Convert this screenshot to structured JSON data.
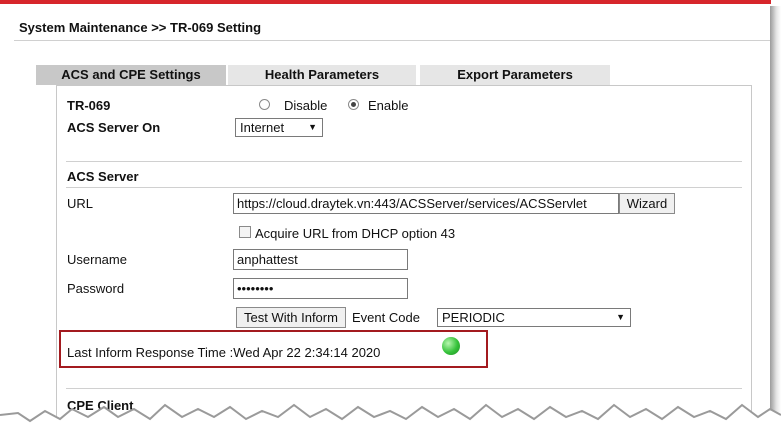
{
  "header": {
    "title": "System Maintenance >> TR-069 Setting"
  },
  "tabs": [
    {
      "label": "ACS and CPE Settings",
      "active": true
    },
    {
      "label": "Health Parameters",
      "active": false
    },
    {
      "label": "Export Parameters",
      "active": false
    }
  ],
  "tr069": {
    "label": "TR-069",
    "options": [
      {
        "label": "Disable",
        "selected": false
      },
      {
        "label": "Enable",
        "selected": true
      }
    ]
  },
  "acs_server_on": {
    "label": "ACS Server On",
    "value": "Internet"
  },
  "acs_server": {
    "section_title": "ACS Server",
    "url_label": "URL",
    "url_value": "https://cloud.draytek.vn:443/ACSServer/services/ACSServlet",
    "wizard_label": "Wizard",
    "acquire_label": "Acquire URL from DHCP option 43",
    "acquire_checked": false,
    "username_label": "Username",
    "username_value": "anphattest",
    "password_label": "Password",
    "password_value": "••••••••",
    "test_button": "Test With Inform",
    "event_code_label": "Event Code",
    "event_code_value": "PERIODIC",
    "last_inform_label": "Last Inform Response Time :",
    "last_inform_value": "Wed Apr 22 2:34:14 2020",
    "status_color": "#35c23a"
  },
  "cpe_client": {
    "section_title": "CPE Client"
  },
  "colors": {
    "accent_red": "#d7262b",
    "highlight_border": "#a31a1f",
    "tab_active": "#c8c8c8",
    "tab_inactive": "#e6e6e6"
  }
}
